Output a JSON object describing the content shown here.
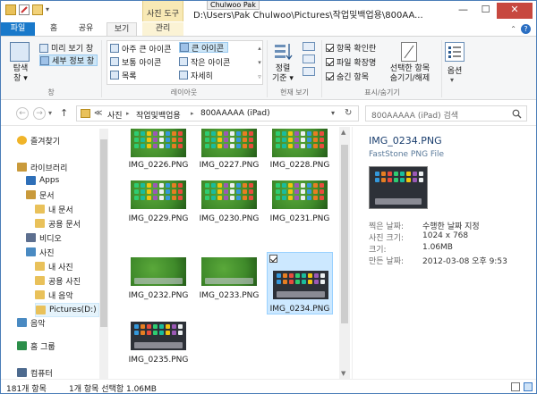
{
  "window": {
    "title": "D:\\Users\\Pak Chulwoo\\Pictures\\작업및백업용\\800AA...",
    "user_tag": "Chulwoo Pak",
    "tool_tab": "사진 도구",
    "min": "—",
    "max": "☐",
    "close": "✕"
  },
  "ribbon_tabs": {
    "file": "파일",
    "home": "홈",
    "share": "공유",
    "view": "보기",
    "manage": "관리"
  },
  "ribbon": {
    "pane_group": {
      "nav_pane": "탐색\n창 ▾",
      "preview_pane": "미리 보기 창",
      "details_pane": "세부 정보 창",
      "label": "창"
    },
    "layout_group": {
      "xl_icons": "아주 큰 아이콘",
      "large_icons": "큰 아이콘",
      "medium_icons": "보통 아이콘",
      "small_icons": "작은 아이콘",
      "list": "목록",
      "details": "자세히",
      "label": "레이아웃"
    },
    "current_view_group": {
      "sort": "정렬\n기준 ▾",
      "label": "현재 보기"
    },
    "show_hide_group": {
      "item_checkboxes": "항목 확인란",
      "file_extensions": "파일 확장명",
      "hidden_items": "숨긴 항목",
      "hide_selected": "선택한 항목\n숨기기/해제",
      "options": "옵션",
      "label": "표시/숨기기"
    }
  },
  "address": {
    "back": "←",
    "forward": "→",
    "up": "↑",
    "prefix": "≪",
    "crumbs": [
      "사진",
      "작업및백업용",
      "800AAAAA (iPad)"
    ],
    "sep": "▸",
    "dropdown": "▾",
    "refresh": "↻",
    "search_placeholder": "800AAAAA (iPad) 검색"
  },
  "nav_pane": {
    "items": [
      {
        "label": "즐겨찾기",
        "icon": "star-icon"
      },
      {
        "label": "라이브러리",
        "icon": "library-icon"
      },
      {
        "label": "Apps",
        "icon": "apps-icon"
      },
      {
        "label": "문서",
        "icon": "documents-icon"
      },
      {
        "label": "내 문서",
        "icon": "folder-icon"
      },
      {
        "label": "공용 문서",
        "icon": "folder-icon"
      },
      {
        "label": "비디오",
        "icon": "video-icon"
      },
      {
        "label": "사진",
        "icon": "pictures-icon"
      },
      {
        "label": "내 사진",
        "icon": "folder-icon"
      },
      {
        "label": "공용 사진",
        "icon": "folder-icon"
      },
      {
        "label": "내 음악",
        "icon": "folder-icon"
      },
      {
        "label": "Pictures(D:)",
        "icon": "folder-icon"
      },
      {
        "label": "음악",
        "icon": "music-icon"
      },
      {
        "label": "홈 그룹",
        "icon": "homegroup-icon"
      },
      {
        "label": "컴퓨터",
        "icon": "computer-icon"
      }
    ]
  },
  "files": [
    {
      "name": "IMG_0226.PNG",
      "theme": "green-icons"
    },
    {
      "name": "IMG_0227.PNG",
      "theme": "green-icons"
    },
    {
      "name": "IMG_0228.PNG",
      "theme": "green-icons"
    },
    {
      "name": "IMG_0229.PNG",
      "theme": "green-icons"
    },
    {
      "name": "IMG_0230.PNG",
      "theme": "green-icons"
    },
    {
      "name": "IMG_0231.PNG",
      "theme": "green-icons"
    },
    {
      "name": "IMG_0232.PNG",
      "theme": "green-dock"
    },
    {
      "name": "IMG_0233.PNG",
      "theme": "green-dock"
    },
    {
      "name": "IMG_0234.PNG",
      "theme": "dark-icons",
      "selected": true
    },
    {
      "name": "IMG_0235.PNG",
      "theme": "dark-icons"
    }
  ],
  "preview": {
    "name": "IMG_0234.PNG",
    "type": "FastStone PNG File",
    "rows": [
      {
        "label": "찍은 날짜:",
        "value": "수행한 날짜 지정"
      },
      {
        "label": "사진 크기:",
        "value": "1024 x 768"
      },
      {
        "label": "크기:",
        "value": "1.06MB"
      },
      {
        "label": "만든 날짜:",
        "value": "2012-03-08 오후 9:53"
      }
    ]
  },
  "status": {
    "count": "181개 항목",
    "selection": "1개 항목 선택함 1.06MB"
  },
  "colors": {
    "accent": "#1979ca",
    "green_wallpaper": "#3f8a2a",
    "dark_wallpaper": "#2d3138",
    "selection": "#cce8ff"
  }
}
